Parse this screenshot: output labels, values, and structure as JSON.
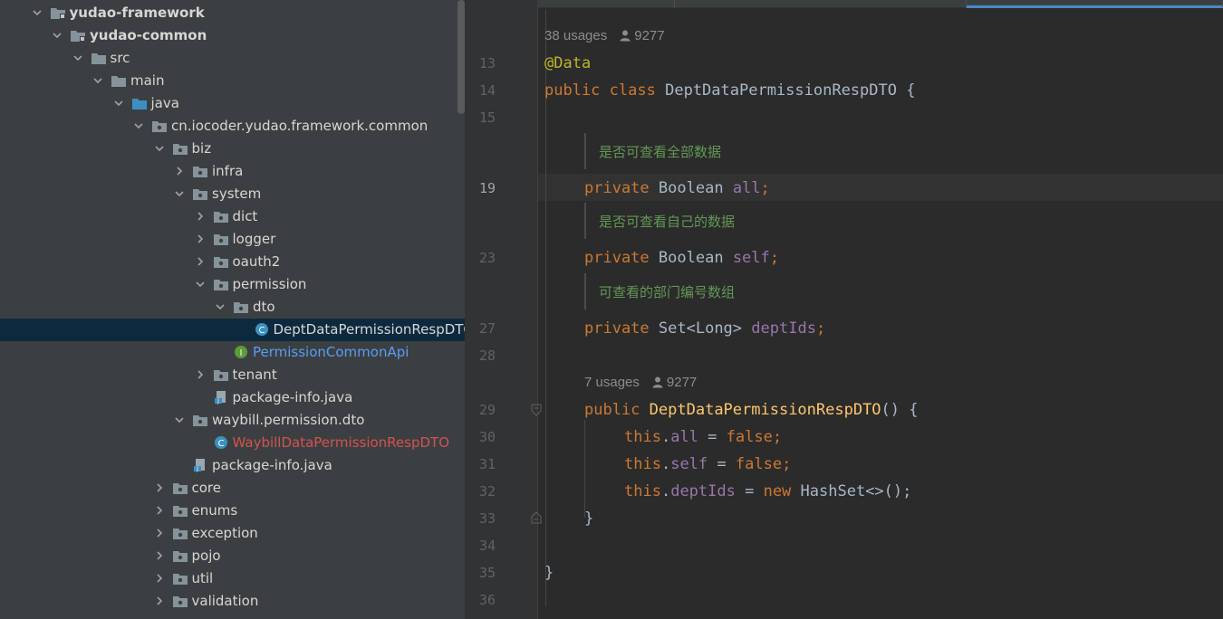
{
  "tree": {
    "items": [
      {
        "label": "yudao-framework",
        "icon": "module-folder-icon",
        "expanded": true,
        "bold": true
      },
      {
        "label": "yudao-common",
        "icon": "module-folder-icon",
        "expanded": true,
        "bold": true
      },
      {
        "label": "src",
        "icon": "folder-icon",
        "expanded": true
      },
      {
        "label": "main",
        "icon": "folder-icon",
        "expanded": true
      },
      {
        "label": "java",
        "icon": "source-root-folder-icon",
        "expanded": true
      },
      {
        "label": "cn.iocoder.yudao.framework.common",
        "icon": "package-icon",
        "expanded": true
      },
      {
        "label": "biz",
        "icon": "package-icon",
        "expanded": true
      },
      {
        "label": "infra",
        "icon": "package-icon",
        "expanded": false
      },
      {
        "label": "system",
        "icon": "package-icon",
        "expanded": true
      },
      {
        "label": "dict",
        "icon": "package-icon",
        "expanded": false
      },
      {
        "label": "logger",
        "icon": "package-icon",
        "expanded": false
      },
      {
        "label": "oauth2",
        "icon": "package-icon",
        "expanded": false
      },
      {
        "label": "permission",
        "icon": "package-icon",
        "expanded": true
      },
      {
        "label": "dto",
        "icon": "package-icon",
        "expanded": true
      },
      {
        "label": "DeptDataPermissionRespDTO",
        "icon": "class-icon",
        "selected": true
      },
      {
        "label": "PermissionCommonApi",
        "icon": "interface-icon",
        "color": "blue"
      },
      {
        "label": "tenant",
        "icon": "package-icon",
        "expanded": false
      },
      {
        "label": "package-info.java",
        "icon": "java-file-icon"
      },
      {
        "label": "waybill.permission.dto",
        "icon": "package-icon",
        "expanded": true
      },
      {
        "label": "WaybillDataPermissionRespDTO",
        "icon": "class-icon",
        "color": "red"
      },
      {
        "label": "package-info.java",
        "icon": "java-file-icon"
      },
      {
        "label": "core",
        "icon": "package-icon",
        "expanded": false
      },
      {
        "label": "enums",
        "icon": "package-icon",
        "expanded": false
      },
      {
        "label": "exception",
        "icon": "package-icon",
        "expanded": false
      },
      {
        "label": "pojo",
        "icon": "package-icon",
        "expanded": false
      },
      {
        "label": "util",
        "icon": "package-icon",
        "expanded": false
      },
      {
        "label": "validation",
        "icon": "package-icon",
        "expanded": false
      }
    ]
  },
  "editor": {
    "line_numbers": {
      "l13": "13",
      "l14": "14",
      "l15": "15",
      "l19": "19",
      "l23": "23",
      "l27": "27",
      "l28": "28",
      "l29": "29",
      "l30": "30",
      "l31": "31",
      "l32": "32",
      "l33": "33",
      "l34": "34",
      "l35": "35",
      "l36": "36"
    },
    "hints": {
      "class_usages": "38 usages",
      "class_author": "9277",
      "ctor_usages": "7 usages",
      "ctor_author": "9277"
    },
    "docs": {
      "all": "是否可查看全部数据",
      "self": "是否可查看自己的数据",
      "deptIds": "可查看的部门编号数组"
    },
    "code": {
      "annotation": "@Data",
      "kw_public": "public",
      "kw_class": "class",
      "class_name": "DeptDataPermissionRespDTO",
      "brace_open": "{",
      "kw_private": "private",
      "type_boolean": "Boolean",
      "field_all": "all",
      "field_self": "self",
      "type_set": "Set<Long>",
      "field_deptIds": "deptIds",
      "semicolon": ";",
      "ctor_name": "DeptDataPermissionRespDTO",
      "ctor_parens": "() {",
      "kw_this": "this",
      "dot": ".",
      "assign": " = ",
      "kw_false": "false",
      "kw_new": "new",
      "hashset": "HashSet<>();",
      "brace_close": "}"
    },
    "colors": {
      "keyword": "#cc7832",
      "annotation": "#bbb529",
      "field": "#9876aa",
      "method": "#ffc66d",
      "doc": "#629755",
      "selected_bg": "#0d293e"
    }
  }
}
